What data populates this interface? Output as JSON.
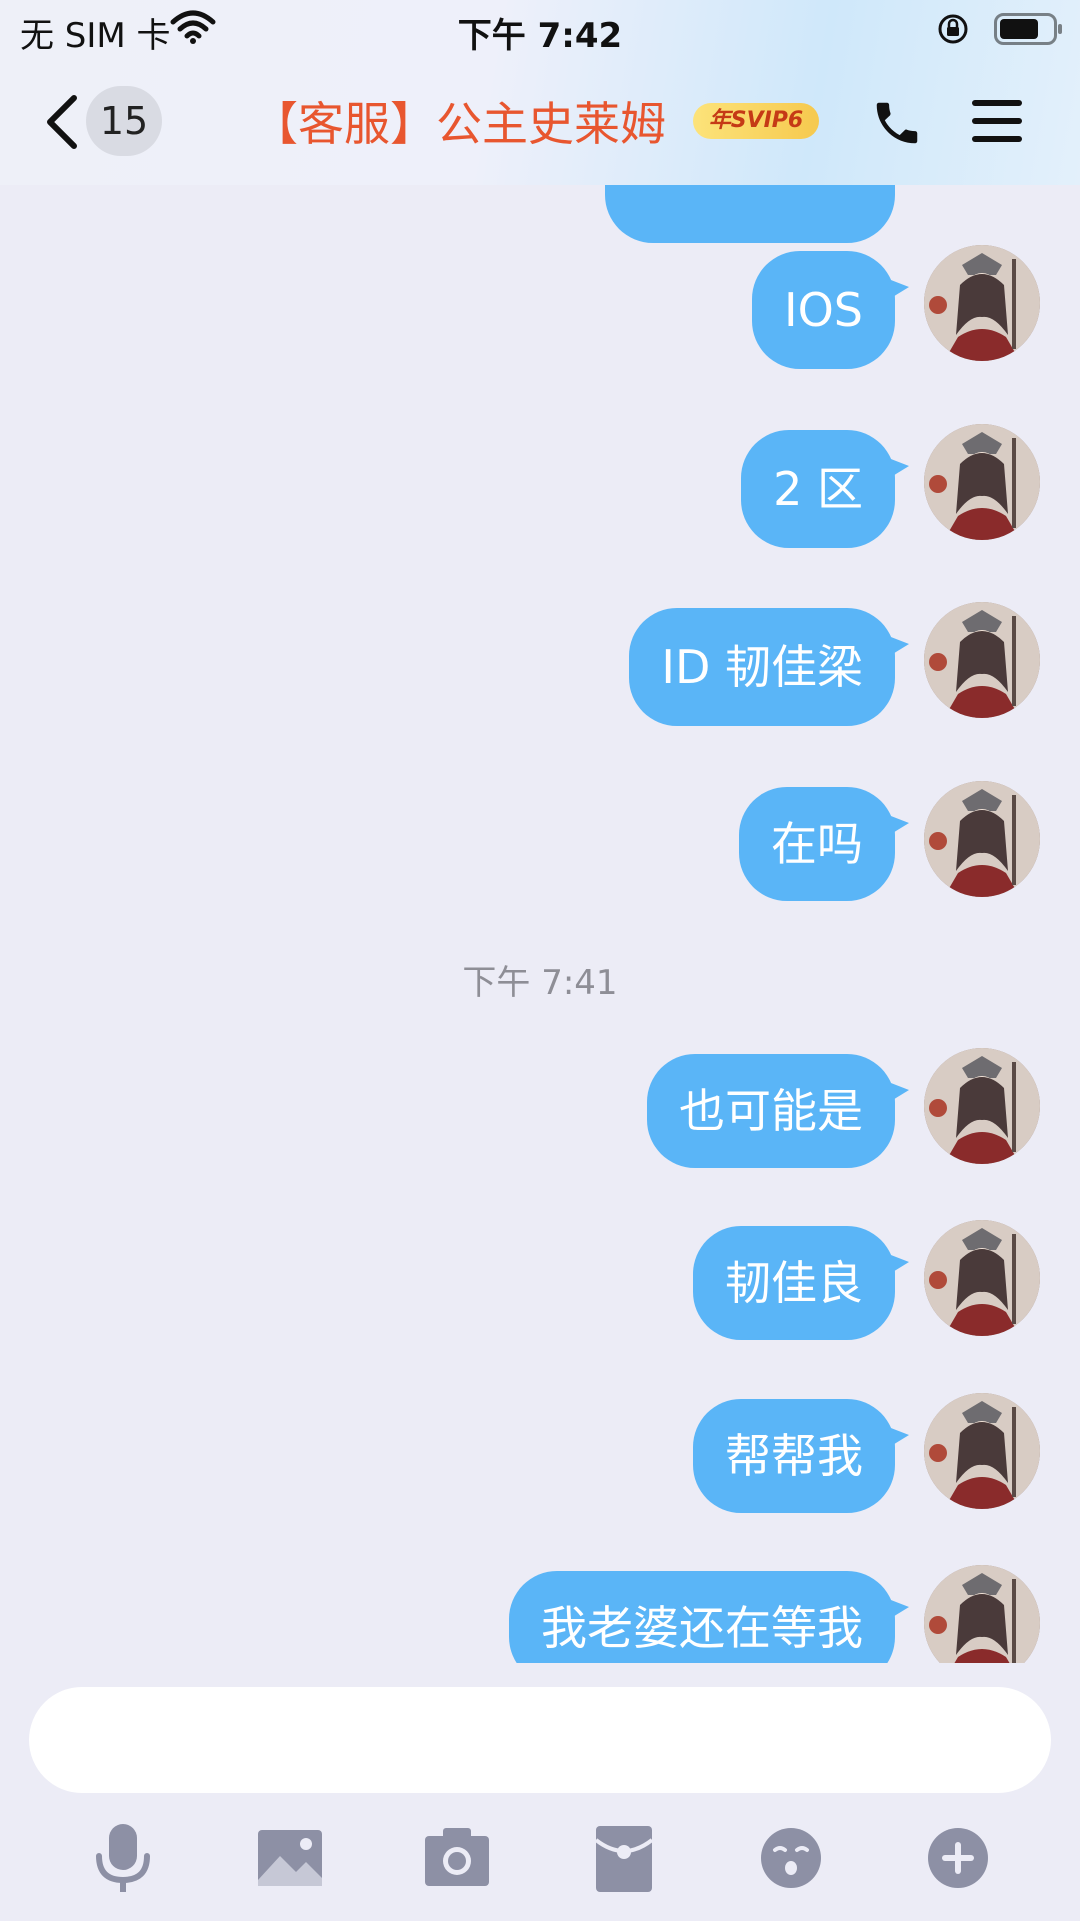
{
  "status_bar": {
    "carrier": "无 SIM 卡",
    "time": "下午 7:42"
  },
  "header": {
    "unread_count": "15",
    "title": "【客服】公主史莱姆",
    "vip_badge": "年SVIP6"
  },
  "messages": [
    {
      "text": "IOS"
    },
    {
      "text": "2 区"
    },
    {
      "text": "ID 韧佳梁"
    },
    {
      "text": "在吗"
    },
    {
      "timestamp": "下午 7:41"
    },
    {
      "text": "也可能是"
    },
    {
      "text": "韧佳良"
    },
    {
      "text": "帮帮我"
    },
    {
      "text": "我老婆还在等我"
    }
  ],
  "input": {
    "placeholder": ""
  },
  "toolbar": [
    "microphone-icon",
    "image-icon",
    "camera-icon",
    "red-packet-icon",
    "emoji-icon",
    "plus-icon"
  ],
  "colors": {
    "bubble": "#5AB5F7",
    "title": "#E8562F",
    "background": "#ECECF6",
    "icon": "#8D90A5"
  }
}
